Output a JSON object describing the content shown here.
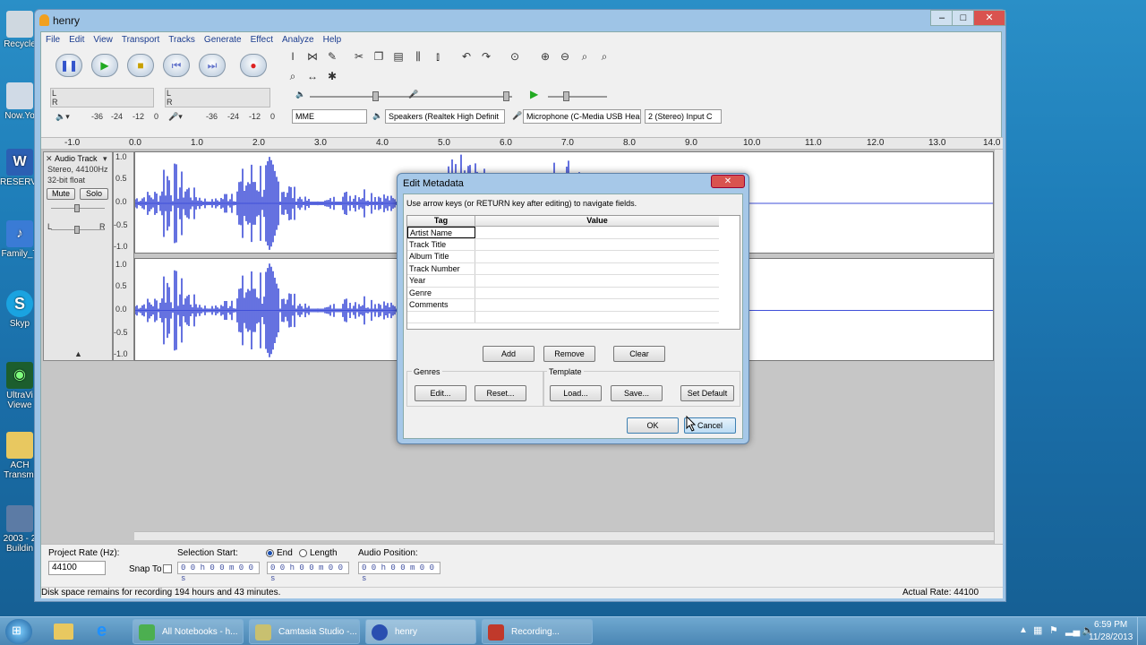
{
  "desktop": {
    "icons": [
      {
        "label": "Recycle"
      },
      {
        "label": "Now.Yo"
      },
      {
        "label": "RESERVE"
      },
      {
        "label": "Family_T"
      },
      {
        "label": "Skyp"
      },
      {
        "label": "UltraVi Viewe"
      },
      {
        "label": "ACH Transmi"
      },
      {
        "label": "2003 - 2 Buildin"
      }
    ]
  },
  "window": {
    "title": "henry",
    "menus": [
      "File",
      "Edit",
      "View",
      "Transport",
      "Tracks",
      "Generate",
      "Effect",
      "Analyze",
      "Help"
    ],
    "meter_scale": [
      "-36",
      "-24",
      "-12",
      "0",
      "-36",
      "-24",
      "-12",
      "0"
    ],
    "device_toolbar": {
      "host": "MME",
      "output": "Speakers (Realtek High Definit",
      "input": "Microphone (C-Media USB Hea",
      "channels": "2 (Stereo) Input C"
    },
    "ruler_ticks": [
      "-1.0",
      "0.0",
      "1.0",
      "2.0",
      "3.0",
      "4.0",
      "5.0",
      "6.0",
      "7.0",
      "8.0",
      "9.0",
      "10.0",
      "11.0",
      "12.0",
      "13.0",
      "14.0"
    ],
    "track": {
      "name": "Audio Track",
      "info1": "Stereo, 44100Hz",
      "info2": "32-bit float",
      "mute": "Mute",
      "solo": "Solo",
      "gain_l": "L",
      "gain_r": "R",
      "scale": [
        "1.0",
        "0.5",
        "0.0",
        "-0.5",
        "-1.0"
      ]
    },
    "selection_bar": {
      "project_rate_label": "Project Rate (Hz):",
      "project_rate": "44100",
      "snap_to": "Snap To",
      "selection_start_label": "Selection Start:",
      "end_label": "End",
      "length_label": "Length",
      "audio_position_label": "Audio Position:",
      "time_value": "0 0 h 0 0 m 0 0 s"
    },
    "status": {
      "left": "Disk space remains for recording 194 hours and 43 minutes.",
      "right": "Actual Rate: 44100"
    }
  },
  "dialog": {
    "title": "Edit Metadata",
    "instructions": "Use arrow keys (or RETURN key after editing) to navigate fields.",
    "col_tag": "Tag",
    "col_value": "Value",
    "rows": [
      "Artist Name",
      "Track Title",
      "Album Title",
      "Track Number",
      "Year",
      "Genre",
      "Comments"
    ],
    "buttons": {
      "add": "Add",
      "remove": "Remove",
      "clear": "Clear",
      "ok": "OK",
      "cancel": "Cancel"
    },
    "genres": {
      "label": "Genres",
      "edit": "Edit...",
      "reset": "Reset..."
    },
    "template": {
      "label": "Template",
      "load": "Load...",
      "save": "Save...",
      "set_default": "Set Default"
    }
  },
  "taskbar": {
    "items": [
      {
        "label": "All Notebooks - h..."
      },
      {
        "label": "Camtasia Studio -..."
      },
      {
        "label": "henry"
      },
      {
        "label": "Recording..."
      }
    ],
    "clock_time": "6:59 PM",
    "clock_date": "11/28/2013"
  }
}
